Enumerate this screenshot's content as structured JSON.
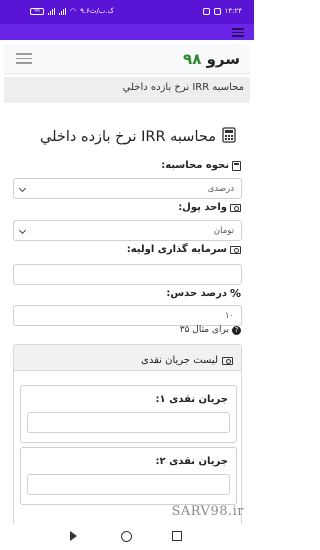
{
  "status": {
    "time": "۱۴:۲۴",
    "battery": "۹۹",
    "speed": "۹.۶ک.ب/ث"
  },
  "navbar": {
    "brand_text": "سرو",
    "brand_number": "۹۸"
  },
  "breadcrumb": "محاسبه IRR نرخ بازده داخلي",
  "page": {
    "title": "محاسبه IRR نرخ بازده داخلي"
  },
  "form": {
    "calc_method_label": "نحوه محاسبه:",
    "calc_method_value": "درصدی",
    "currency_label": "واحد پول:",
    "currency_value": "تومان",
    "initial_investment_label": "سرمایه گذاری اولیه:",
    "initial_investment_value": "",
    "guess_label": "درصد حدس:",
    "guess_value": "۱۰",
    "guess_hint": "برای مثال ۳۵"
  },
  "cashflow": {
    "header": "لیست جریان نقدی",
    "items": [
      {
        "label": "جریان نقدی ۱:",
        "value": ""
      },
      {
        "label": "جریان نقدی ۲:",
        "value": ""
      }
    ]
  },
  "watermark": "SARV98.ir",
  "icons": {
    "menu": "hamburger-icon",
    "calculator": "calculator-icon",
    "money": "money-icon",
    "percent": "percent-icon",
    "question": "question-circle-icon"
  },
  "colors": {
    "statusbar": "#5a14d6",
    "appbar": "#6a25e6",
    "brand_number": "#2e8a2e"
  }
}
